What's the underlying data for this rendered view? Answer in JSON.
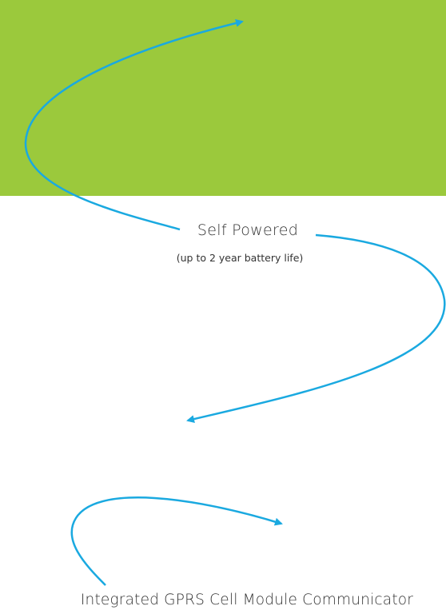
{
  "colors": {
    "panel": "#9bc93c",
    "arrow": "#1aa9e0",
    "text": "#333333"
  },
  "labels": {
    "self_powered": "Self Powered",
    "battery_life": "(up to 2 year battery life)",
    "gprs": "Integrated GPRS Cell Module Communicator"
  },
  "icons": {
    "arrow_head": "arrow-head-icon"
  }
}
